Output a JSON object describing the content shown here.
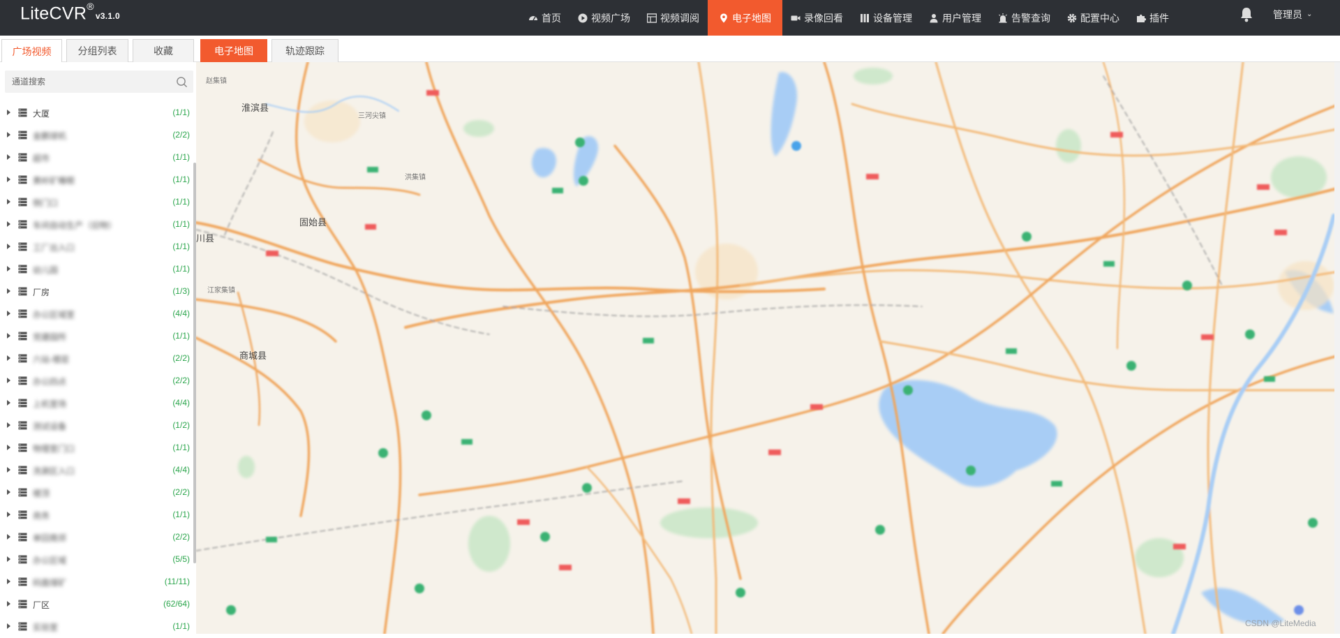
{
  "app": {
    "name": "LiteCVR",
    "reg": "®",
    "version": "v3.1.0"
  },
  "nav": [
    {
      "label": "首页",
      "icon": "dashboard-icon"
    },
    {
      "label": "视频广场",
      "icon": "play-circle-icon"
    },
    {
      "label": "视频调阅",
      "icon": "grid-icon"
    },
    {
      "label": "电子地图",
      "icon": "map-pin-icon",
      "active": true
    },
    {
      "label": "录像回看",
      "icon": "video-camera-icon"
    },
    {
      "label": "设备管理",
      "icon": "device-icon"
    },
    {
      "label": "用户管理",
      "icon": "user-icon"
    },
    {
      "label": "告警查询",
      "icon": "alarm-icon"
    },
    {
      "label": "配置中心",
      "icon": "gear-icon"
    },
    {
      "label": "插件",
      "icon": "puzzle-icon"
    }
  ],
  "user": {
    "label": "管理员"
  },
  "tabs": {
    "left": [
      "广场视频",
      "分组列表",
      "收藏"
    ],
    "right": [
      "电子地图",
      "轨迹跟踪"
    ]
  },
  "search": {
    "placeholder": "通道搜索"
  },
  "tree": [
    {
      "label": "大厦",
      "count": "(1/1)"
    },
    {
      "label": "金鹏球机",
      "count": "(2/2)",
      "blurred": true
    },
    {
      "label": "超市",
      "count": "(1/1)",
      "blurred": true
    },
    {
      "label": "黄岭矿睡眼",
      "count": "(1/1)",
      "blurred": true
    },
    {
      "label": "侧门口",
      "count": "(1/1)",
      "blurred": true
    },
    {
      "label": "车间自动生产（旧物）",
      "count": "(1/1)",
      "blurred": true
    },
    {
      "label": "工厂出入口",
      "count": "(1/1)",
      "blurred": true
    },
    {
      "label": "幼儿园",
      "count": "(1/1)",
      "blurred": true
    },
    {
      "label": "厂房",
      "count": "(1/3)"
    },
    {
      "label": "办公区域室",
      "count": "(4/4)",
      "blurred": true
    },
    {
      "label": "党建园所",
      "count": "(1/1)",
      "blurred": true
    },
    {
      "label": "六站-楼层",
      "count": "(2/2)",
      "blurred": true
    },
    {
      "label": "办公四点",
      "count": "(2/2)",
      "blurred": true
    },
    {
      "label": "上机室场",
      "count": "(4/4)",
      "blurred": true
    },
    {
      "label": "测试设备",
      "count": "(1/2)",
      "blurred": true
    },
    {
      "label": "物理室门口",
      "count": "(1/1)",
      "blurred": true
    },
    {
      "label": "洗涮区入口",
      "count": "(4/4)",
      "blurred": true
    },
    {
      "label": "楼顶",
      "count": "(2/2)",
      "blurred": true
    },
    {
      "label": "商务",
      "count": "(1/1)",
      "blurred": true
    },
    {
      "label": "单回南郊",
      "count": "(2/2)",
      "blurred": true
    },
    {
      "label": "办公区域",
      "count": "(5/5)",
      "blurred": true
    },
    {
      "label": "码面煤矿",
      "count": "(11/11)",
      "blurred": true
    },
    {
      "label": "厂区",
      "count": "(62/64)"
    },
    {
      "label": "实验室",
      "count": "(1/1)",
      "blurred": true
    }
  ],
  "map": {
    "labels": [
      "淮滨县",
      "固始县",
      "商城县",
      "川县",
      "赵集镇",
      "江家集镇",
      "三河尖镇",
      "洪集镇"
    ],
    "watermark": "CSDN @LiteMedia",
    "colors": {
      "road": "#f0a65d",
      "water": "#a8cdf5",
      "land": "#f6f2ea",
      "park": "#cfe8cc",
      "poi": "#3bb273"
    }
  }
}
